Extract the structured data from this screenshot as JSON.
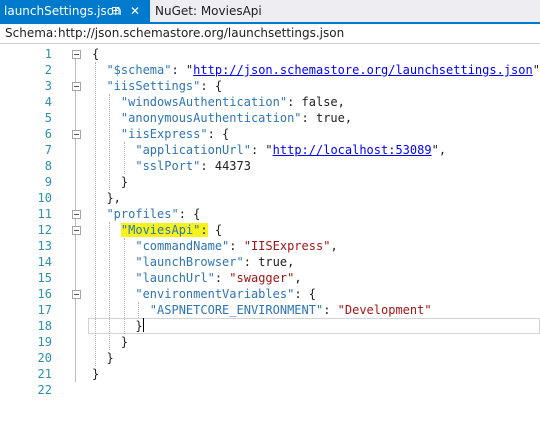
{
  "tabs": [
    {
      "label": "launchSettings.json",
      "pin": "⊟",
      "close": "✕",
      "active": true
    },
    {
      "label": "NuGet: MoviesApi",
      "active": false
    }
  ],
  "schema_bar": {
    "label": "Schema:",
    "url": "http://json.schemastore.org/launchsettings.json"
  },
  "editor": {
    "lines": [
      {
        "n": "1",
        "t": [
          [
            "p",
            "{"
          ]
        ]
      },
      {
        "n": "2",
        "t": [
          [
            "p",
            "  "
          ],
          [
            "k",
            "\"$schema\""
          ],
          [
            "p",
            ": \""
          ],
          [
            "lnk",
            "http://json.schemastore.org/launchsettings.json"
          ],
          [
            "p",
            "\","
          ]
        ]
      },
      {
        "n": "3",
        "t": [
          [
            "p",
            "  "
          ],
          [
            "k",
            "\"iisSettings\""
          ],
          [
            "p",
            ": {"
          ]
        ]
      },
      {
        "n": "4",
        "t": [
          [
            "p",
            "    "
          ],
          [
            "k",
            "\"windowsAuthentication\""
          ],
          [
            "p",
            ": "
          ],
          [
            "n",
            "false"
          ],
          [
            "p",
            ","
          ]
        ]
      },
      {
        "n": "5",
        "t": [
          [
            "p",
            "    "
          ],
          [
            "k",
            "\"anonymousAuthentication\""
          ],
          [
            "p",
            ": "
          ],
          [
            "n",
            "true"
          ],
          [
            "p",
            ","
          ]
        ]
      },
      {
        "n": "6",
        "t": [
          [
            "p",
            "    "
          ],
          [
            "k",
            "\"iisExpress\""
          ],
          [
            "p",
            ": {"
          ]
        ]
      },
      {
        "n": "7",
        "t": [
          [
            "p",
            "      "
          ],
          [
            "k",
            "\"applicationUrl\""
          ],
          [
            "p",
            ": \""
          ],
          [
            "lnk",
            "http://localhost:53089"
          ],
          [
            "p",
            "\","
          ]
        ]
      },
      {
        "n": "8",
        "t": [
          [
            "p",
            "      "
          ],
          [
            "k",
            "\"sslPort\""
          ],
          [
            "p",
            ": "
          ],
          [
            "n",
            "44373"
          ]
        ]
      },
      {
        "n": "9",
        "t": [
          [
            "p",
            "    }"
          ]
        ]
      },
      {
        "n": "10",
        "t": [
          [
            "p",
            "  },"
          ]
        ]
      },
      {
        "n": "11",
        "t": [
          [
            "p",
            "  "
          ],
          [
            "k",
            "\"profiles\""
          ],
          [
            "p",
            ": {"
          ]
        ]
      },
      {
        "n": "12",
        "t": [
          [
            "p",
            "    "
          ],
          [
            "khl",
            "\"MoviesApi\""
          ],
          [
            "phl",
            ":"
          ],
          [
            "p",
            " {"
          ]
        ]
      },
      {
        "n": "13",
        "t": [
          [
            "p",
            "      "
          ],
          [
            "k",
            "\"commandName\""
          ],
          [
            "p",
            ": "
          ],
          [
            "s",
            "\"IISExpress\""
          ],
          [
            "p",
            ","
          ]
        ]
      },
      {
        "n": "14",
        "t": [
          [
            "p",
            "      "
          ],
          [
            "k",
            "\"launchBrowser\""
          ],
          [
            "p",
            ": "
          ],
          [
            "n",
            "true"
          ],
          [
            "p",
            ","
          ]
        ]
      },
      {
        "n": "15",
        "t": [
          [
            "p",
            "      "
          ],
          [
            "k",
            "\"launchUrl\""
          ],
          [
            "p",
            ": "
          ],
          [
            "s",
            "\"swagger\""
          ],
          [
            "p",
            ","
          ]
        ]
      },
      {
        "n": "16",
        "t": [
          [
            "p",
            "      "
          ],
          [
            "k",
            "\"environmentVariables\""
          ],
          [
            "p",
            ": {"
          ]
        ]
      },
      {
        "n": "17",
        "t": [
          [
            "p",
            "        "
          ],
          [
            "k",
            "\"ASPNETCORE_ENVIRONMENT\""
          ],
          [
            "p",
            ": "
          ],
          [
            "s",
            "\"Development\""
          ]
        ]
      },
      {
        "n": "18",
        "t": [
          [
            "p",
            "      }"
          ],
          [
            "caret",
            ""
          ]
        ]
      },
      {
        "n": "19",
        "t": [
          [
            "p",
            "    }"
          ]
        ]
      },
      {
        "n": "20",
        "t": [
          [
            "p",
            "  }"
          ]
        ]
      },
      {
        "n": "21",
        "t": [
          [
            "p",
            "}"
          ]
        ]
      },
      {
        "n": "22",
        "t": []
      }
    ],
    "fold_lines": [
      1,
      3,
      6,
      11,
      12,
      16
    ]
  },
  "colors": {
    "accent": "#007acc",
    "line_number": "#2b91af",
    "json_key": "#2e75b6",
    "json_string": "#a31515",
    "json_link": "#0000ff",
    "highlight": "#f7f21c"
  }
}
